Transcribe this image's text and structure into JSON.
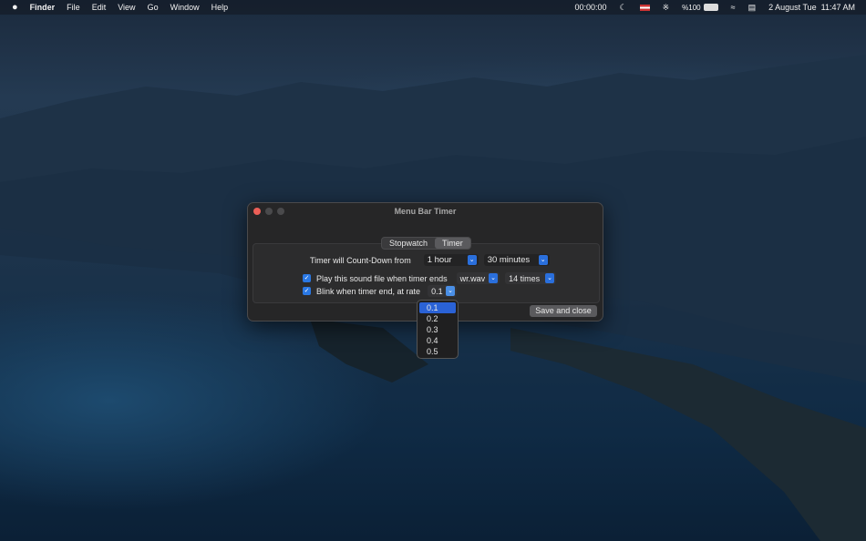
{
  "menubar": {
    "apple": "",
    "app": "Finder",
    "menus": [
      "File",
      "Edit",
      "View",
      "Go",
      "Window",
      "Help"
    ],
    "timer": "00:00:00",
    "battery": "%100",
    "datetime": "2 August Tue  11:47 AM"
  },
  "window": {
    "title": "Menu Bar Timer",
    "tabs": [
      "Stopwatch",
      "Timer"
    ],
    "active_tab": "Timer",
    "countdown_label": "Timer will Count-Down from",
    "hours": "1 hour",
    "minutes": "30 minutes",
    "sound_label": "Play this sound file when timer ends",
    "sound_checked": true,
    "sound_file": "wr.wav",
    "repeat": "14 times",
    "blink_label": "Blink when timer end, at rate",
    "blink_checked": true,
    "rate": "0.1",
    "save_button": "Save and close"
  },
  "rate_dropdown": {
    "options": [
      "0.1",
      "0.2",
      "0.3",
      "0.4",
      "0.5"
    ],
    "selected": "0.1"
  }
}
